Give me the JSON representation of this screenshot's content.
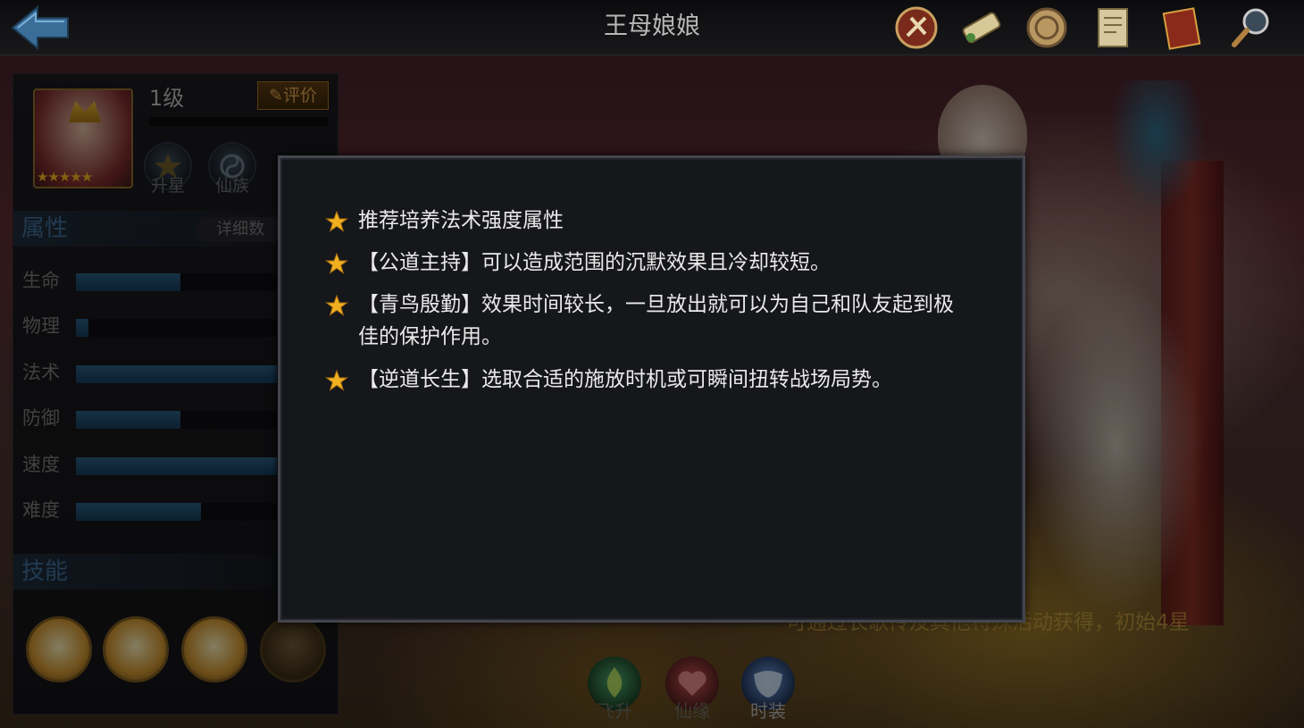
{
  "header": {
    "title": "王母娘娘"
  },
  "hero": {
    "level": "1级",
    "rate_label": "评价",
    "stars": "★★★★★",
    "buttons": [
      {
        "label": "升星"
      },
      {
        "label": "仙族"
      }
    ]
  },
  "attributes": {
    "title": "属性",
    "detail_label": "详细数",
    "stats": [
      {
        "label": "生命",
        "value": 0.52
      },
      {
        "label": "物理",
        "value": 0.06
      },
      {
        "label": "法术",
        "value": 1.0
      },
      {
        "label": "防御",
        "value": 0.52
      },
      {
        "label": "速度",
        "value": 1.0
      },
      {
        "label": "难度",
        "value": 0.62
      }
    ]
  },
  "skills": {
    "title": "技能"
  },
  "background_text": "可通过长歌传及其他特殊活动获得，初始4星",
  "bottom_tabs": [
    {
      "label": "飞升"
    },
    {
      "label": "仙缘"
    },
    {
      "label": "时装"
    }
  ],
  "modal": {
    "tips": [
      "推荐培养法术强度属性",
      "【公道主持】可以造成范围的沉默效果且冷却较短。",
      "【青鸟殷勤】效果时间较长，一旦放出就可以为自己和队友起到极佳的保护作用。",
      "【逆道长生】选取合适的施放时机或可瞬间扭转战场局势。"
    ]
  },
  "colors": {
    "accent_blue": "#3d6a94",
    "star_gold": "#f0b020",
    "modal_bg": "#16171b"
  }
}
